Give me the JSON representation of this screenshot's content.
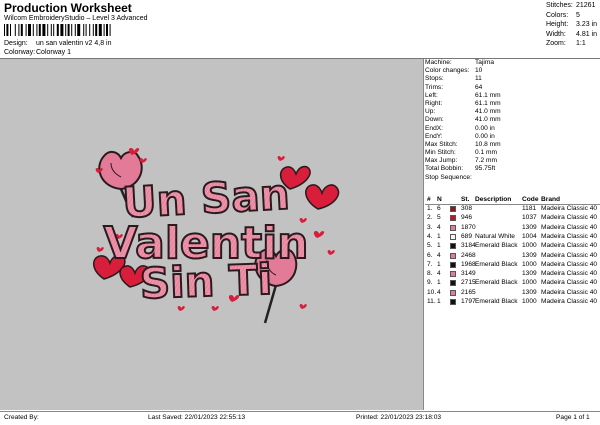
{
  "header": {
    "title": "Production Worksheet",
    "subtitle": "Wilcom EmbroideryStudio – Level 3 Advanced",
    "design_label": "Design:",
    "design_value": "un san valentin v2 4,8 in",
    "colorway_label": "Colorway:",
    "colorway_value": "Colorway 1"
  },
  "summary": [
    {
      "k": "Stitches:",
      "v": "21261"
    },
    {
      "k": "Colors:",
      "v": "5"
    },
    {
      "k": "Height:",
      "v": "3.23 in"
    },
    {
      "k": "Width:",
      "v": "4.81 in"
    },
    {
      "k": "Zoom:",
      "v": "1:1"
    }
  ],
  "machine_info": [
    {
      "k": "Machine:",
      "v": "Tajima"
    },
    {
      "k": "Color changes:",
      "v": "10"
    },
    {
      "k": "Stops:",
      "v": "11"
    },
    {
      "k": "Trims:",
      "v": "64"
    },
    {
      "k": "Left:",
      "v": "61.1 mm"
    },
    {
      "k": "Right:",
      "v": "61.1 mm"
    },
    {
      "k": "Up:",
      "v": "41.0 mm"
    },
    {
      "k": "Down:",
      "v": "41.0 mm"
    },
    {
      "k": "EndX:",
      "v": "0.00 in"
    },
    {
      "k": "EndY:",
      "v": "0.00 in"
    },
    {
      "k": "Max Stitch:",
      "v": "10.8 mm"
    },
    {
      "k": "Min Stitch:",
      "v": "0.1 mm"
    },
    {
      "k": "Max Jump:",
      "v": "7.2 mm"
    },
    {
      "k": "Total Bobbin:",
      "v": "95.75ft"
    },
    {
      "k": "Stop Sequence:",
      "v": ""
    }
  ],
  "stop_table": {
    "headers": [
      "#",
      "N",
      "St.",
      "Description",
      "Code",
      "Brand"
    ],
    "rows": [
      {
        "num": "1.",
        "n": "6",
        "st": "308",
        "desc": "",
        "code": "1181",
        "brand": "Madeira Classic 40",
        "color": "#8b1a1a"
      },
      {
        "num": "2.",
        "n": "5",
        "st": "946",
        "desc": "",
        "code": "1037",
        "brand": "Madeira Classic 40",
        "color": "#c8102e"
      },
      {
        "num": "3.",
        "n": "4",
        "st": "1870",
        "desc": "",
        "code": "1309",
        "brand": "Madeira Classic 40",
        "color": "#e07aa0"
      },
      {
        "num": "4.",
        "n": "1",
        "st": "689",
        "desc": "Natural White",
        "code": "1004",
        "brand": "Madeira Classic 40",
        "color": "#f4f4f4"
      },
      {
        "num": "5.",
        "n": "1",
        "st": "3184",
        "desc": "Emerald Black",
        "code": "1000",
        "brand": "Madeira Classic 40",
        "color": "#111111"
      },
      {
        "num": "6.",
        "n": "4",
        "st": "2468",
        "desc": "",
        "code": "1309",
        "brand": "Madeira Classic 40",
        "color": "#e07aa0"
      },
      {
        "num": "7.",
        "n": "1",
        "st": "1968",
        "desc": "Emerald Black",
        "code": "1000",
        "brand": "Madeira Classic 40",
        "color": "#111111"
      },
      {
        "num": "8.",
        "n": "4",
        "st": "3149",
        "desc": "",
        "code": "1309",
        "brand": "Madeira Classic 40",
        "color": "#e07aa0"
      },
      {
        "num": "9.",
        "n": "1",
        "st": "2715",
        "desc": "Emerald Black",
        "code": "1000",
        "brand": "Madeira Classic 40",
        "color": "#111111"
      },
      {
        "num": "10.",
        "n": "4",
        "st": "2165",
        "desc": "",
        "code": "1309",
        "brand": "Madeira Classic 40",
        "color": "#e07aa0"
      },
      {
        "num": "11.",
        "n": "1",
        "st": "1797",
        "desc": "Emerald Black",
        "code": "1000",
        "brand": "Madeira Classic 40",
        "color": "#111111"
      }
    ]
  },
  "design": {
    "line1": "Un San",
    "line2": "Valentin",
    "line3": "Sin Ti",
    "text_color": "#e8889f",
    "outline_color": "#2a1a1f",
    "heart_color": "#d81e3a",
    "lollipop_color": "#e37a98",
    "background": "#c2c2c2"
  },
  "footer": {
    "created": "Created By:",
    "saved": "Last Saved: 22/01/2023 22:55:13",
    "printed": "Printed: 22/01/2023 23:18:03",
    "page": "Page 1 of 1"
  }
}
